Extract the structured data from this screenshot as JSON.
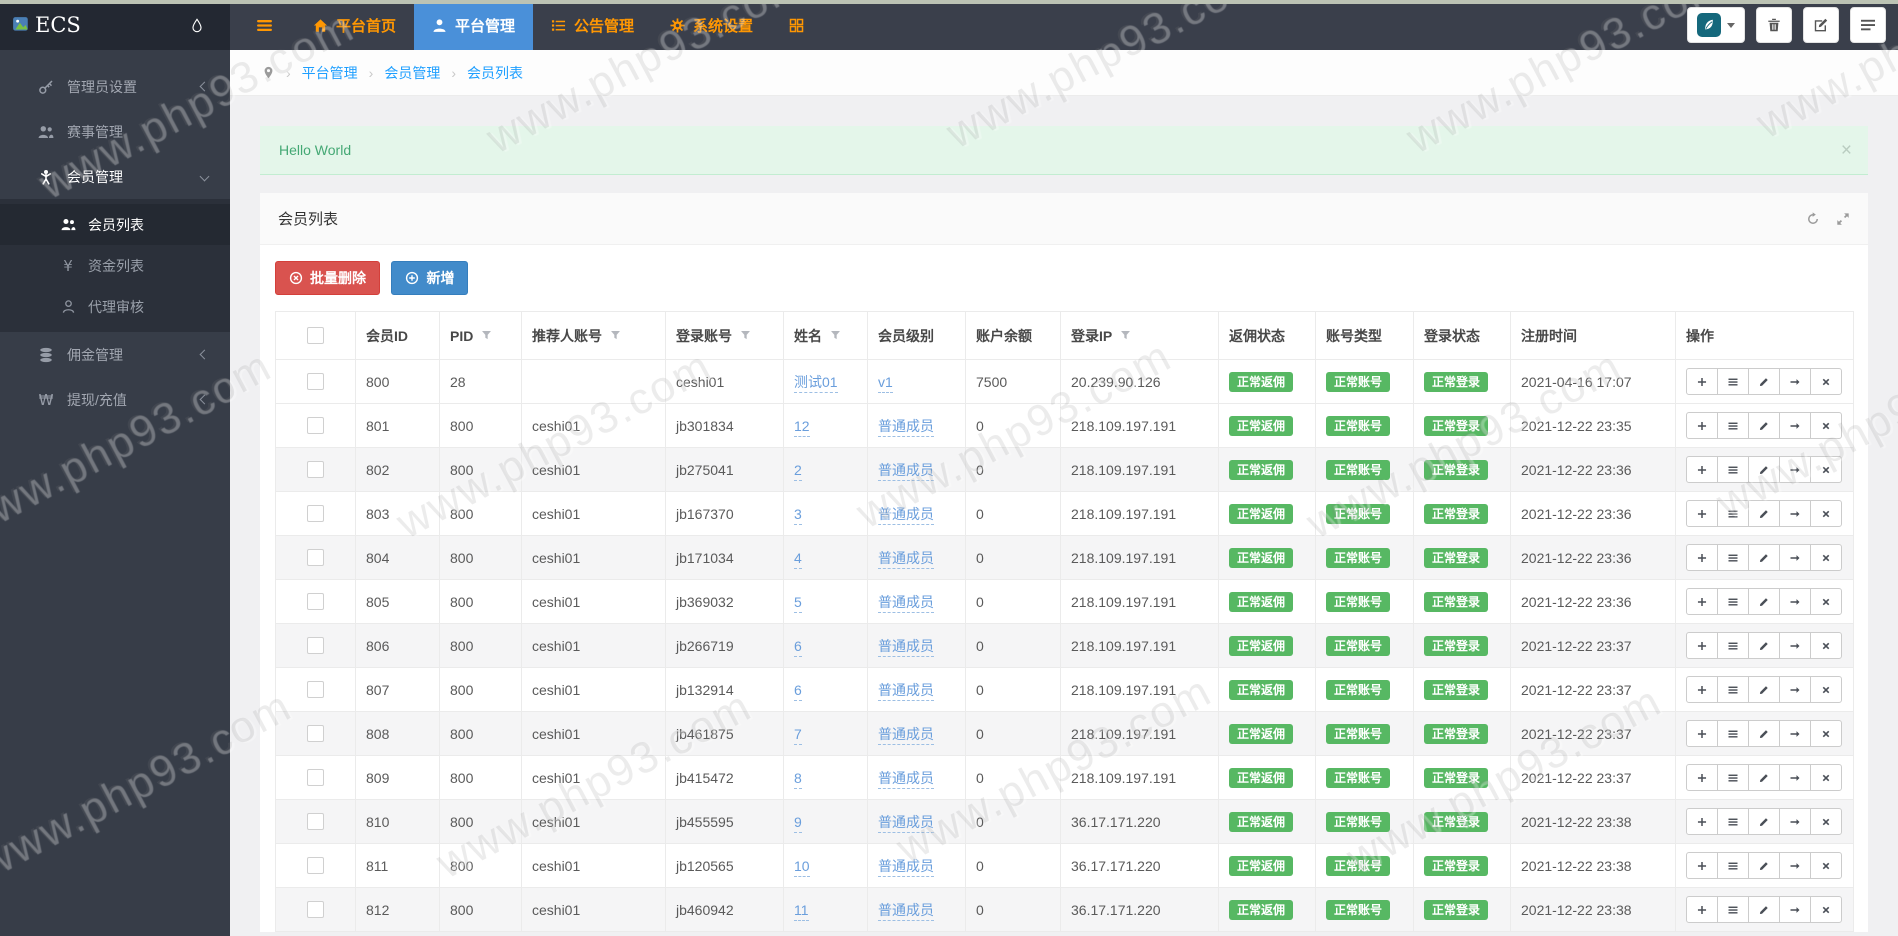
{
  "watermark": {
    "text": "www.php93.com"
  },
  "colors": {
    "nav_bg": "#3a3f4b",
    "logo_bg": "#232832",
    "sidebar_bg": "#373d48",
    "nav_accent_orange": "#ff9702",
    "active_tab_blue": "#4a90d9",
    "breadcrumb_link_blue": "#1e9fff",
    "alert_green_bg": "#e4f6ea",
    "alert_green_text": "#44a874",
    "badge_green": "#57b863",
    "danger_red": "#d9534f",
    "primary_blue": "#428bca",
    "table_link_blue": "#6a9edc"
  },
  "topbar": {
    "logo_text": "ECS",
    "menus": [
      {
        "key": "home",
        "icon": "home-icon",
        "label": "平台首页",
        "active": false
      },
      {
        "key": "platform",
        "icon": "user-icon",
        "label": "平台管理",
        "active": true
      },
      {
        "key": "notice",
        "icon": "announcement-icon",
        "label": "公告管理",
        "active": false
      },
      {
        "key": "system",
        "icon": "gear-icon",
        "label": "系统设置",
        "active": false
      },
      {
        "key": "apps",
        "icon": "grid-icon",
        "label": "",
        "active": false
      }
    ],
    "tools": [
      "extension-icon",
      "trash-icon",
      "edit-square-icon",
      "list-icon"
    ]
  },
  "sidebar": {
    "items": [
      {
        "key": "admin-settings",
        "icon": "key-icon",
        "label": "管理员设置",
        "chevron": "left"
      },
      {
        "key": "match-manage",
        "icon": "users-icon",
        "label": "赛事管理"
      },
      {
        "key": "member-manage",
        "icon": "person-icon",
        "label": "会员管理",
        "chevron": "down",
        "open": true,
        "children": [
          {
            "key": "member-list",
            "icon": "users-icon",
            "label": "会员列表",
            "active": true
          },
          {
            "key": "fund-list",
            "icon": "yen-icon",
            "label": "资金列表"
          },
          {
            "key": "agent-audit",
            "icon": "agent-icon",
            "label": "代理审核"
          }
        ]
      },
      {
        "key": "commission-manage",
        "icon": "database-icon",
        "label": "佣金管理",
        "chevron": "left"
      },
      {
        "key": "withdraw-recharge",
        "icon": "won-icon",
        "label": "提现/充值",
        "chevron": "left"
      }
    ]
  },
  "breadcrumb": {
    "items": [
      "平台管理",
      "会员管理",
      "会员列表"
    ]
  },
  "alert": {
    "message": "Hello World",
    "close_label": "×"
  },
  "panel": {
    "title": "会员列表"
  },
  "toolbar": {
    "batch_delete_label": "批量删除",
    "add_label": "新增"
  },
  "table": {
    "headers": [
      {
        "key": "select",
        "label": "",
        "checkbox": true
      },
      {
        "key": "id",
        "label": "会员ID"
      },
      {
        "key": "pid",
        "label": "PID",
        "filter": true
      },
      {
        "key": "referrer",
        "label": "推荐人账号",
        "filter": true
      },
      {
        "key": "account",
        "label": "登录账号",
        "filter": true
      },
      {
        "key": "name",
        "label": "姓名",
        "filter": true
      },
      {
        "key": "level",
        "label": "会员级别"
      },
      {
        "key": "balance",
        "label": "账户余额"
      },
      {
        "key": "ip",
        "label": "登录IP",
        "filter": true
      },
      {
        "key": "rebate_status",
        "label": "返佣状态"
      },
      {
        "key": "account_type",
        "label": "账号类型"
      },
      {
        "key": "login_status",
        "label": "登录状态"
      },
      {
        "key": "reg_time",
        "label": "注册时间"
      },
      {
        "key": "actions",
        "label": "操作"
      }
    ],
    "row_actions": [
      "add-icon",
      "detail-icon",
      "edit-icon",
      "transfer-icon",
      "delete-icon"
    ],
    "rows": [
      {
        "id": "800",
        "pid": "28",
        "referrer": "",
        "account": "ceshi01",
        "name": "测试01",
        "level": "v1",
        "balance": "7500",
        "ip": "20.239.90.126",
        "rebate_status": "正常返佣",
        "account_type": "正常账号",
        "login_status": "正常登录",
        "reg_time": "2021-04-16 17:07"
      },
      {
        "id": "801",
        "pid": "800",
        "referrer": "ceshi01",
        "account": "jb301834",
        "name": "12",
        "level": "普通成员",
        "balance": "0",
        "ip": "218.109.197.191",
        "rebate_status": "正常返佣",
        "account_type": "正常账号",
        "login_status": "正常登录",
        "reg_time": "2021-12-22 23:35"
      },
      {
        "id": "802",
        "pid": "800",
        "referrer": "ceshi01",
        "account": "jb275041",
        "name": "2",
        "level": "普通成员",
        "balance": "0",
        "ip": "218.109.197.191",
        "rebate_status": "正常返佣",
        "account_type": "正常账号",
        "login_status": "正常登录",
        "reg_time": "2021-12-22 23:36"
      },
      {
        "id": "803",
        "pid": "800",
        "referrer": "ceshi01",
        "account": "jb167370",
        "name": "3",
        "level": "普通成员",
        "balance": "0",
        "ip": "218.109.197.191",
        "rebate_status": "正常返佣",
        "account_type": "正常账号",
        "login_status": "正常登录",
        "reg_time": "2021-12-22 23:36"
      },
      {
        "id": "804",
        "pid": "800",
        "referrer": "ceshi01",
        "account": "jb171034",
        "name": "4",
        "level": "普通成员",
        "balance": "0",
        "ip": "218.109.197.191",
        "rebate_status": "正常返佣",
        "account_type": "正常账号",
        "login_status": "正常登录",
        "reg_time": "2021-12-22 23:36"
      },
      {
        "id": "805",
        "pid": "800",
        "referrer": "ceshi01",
        "account": "jb369032",
        "name": "5",
        "level": "普通成员",
        "balance": "0",
        "ip": "218.109.197.191",
        "rebate_status": "正常返佣",
        "account_type": "正常账号",
        "login_status": "正常登录",
        "reg_time": "2021-12-22 23:36"
      },
      {
        "id": "806",
        "pid": "800",
        "referrer": "ceshi01",
        "account": "jb266719",
        "name": "6",
        "level": "普通成员",
        "balance": "0",
        "ip": "218.109.197.191",
        "rebate_status": "正常返佣",
        "account_type": "正常账号",
        "login_status": "正常登录",
        "reg_time": "2021-12-22 23:37"
      },
      {
        "id": "807",
        "pid": "800",
        "referrer": "ceshi01",
        "account": "jb132914",
        "name": "6",
        "level": "普通成员",
        "balance": "0",
        "ip": "218.109.197.191",
        "rebate_status": "正常返佣",
        "account_type": "正常账号",
        "login_status": "正常登录",
        "reg_time": "2021-12-22 23:37"
      },
      {
        "id": "808",
        "pid": "800",
        "referrer": "ceshi01",
        "account": "jb461875",
        "name": "7",
        "level": "普通成员",
        "balance": "0",
        "ip": "218.109.197.191",
        "rebate_status": "正常返佣",
        "account_type": "正常账号",
        "login_status": "正常登录",
        "reg_time": "2021-12-22 23:37"
      },
      {
        "id": "809",
        "pid": "800",
        "referrer": "ceshi01",
        "account": "jb415472",
        "name": "8",
        "level": "普通成员",
        "balance": "0",
        "ip": "218.109.197.191",
        "rebate_status": "正常返佣",
        "account_type": "正常账号",
        "login_status": "正常登录",
        "reg_time": "2021-12-22 23:37"
      },
      {
        "id": "810",
        "pid": "800",
        "referrer": "ceshi01",
        "account": "jb455595",
        "name": "9",
        "level": "普通成员",
        "balance": "0",
        "ip": "36.17.171.220",
        "rebate_status": "正常返佣",
        "account_type": "正常账号",
        "login_status": "正常登录",
        "reg_time": "2021-12-22 23:38"
      },
      {
        "id": "811",
        "pid": "800",
        "referrer": "ceshi01",
        "account": "jb120565",
        "name": "10",
        "level": "普通成员",
        "balance": "0",
        "ip": "36.17.171.220",
        "rebate_status": "正常返佣",
        "account_type": "正常账号",
        "login_status": "正常登录",
        "reg_time": "2021-12-22 23:38"
      },
      {
        "id": "812",
        "pid": "800",
        "referrer": "ceshi01",
        "account": "jb460942",
        "name": "11",
        "level": "普通成员",
        "balance": "0",
        "ip": "36.17.171.220",
        "rebate_status": "正常返佣",
        "account_type": "正常账号",
        "login_status": "正常登录",
        "reg_time": "2021-12-22 23:38"
      }
    ]
  }
}
